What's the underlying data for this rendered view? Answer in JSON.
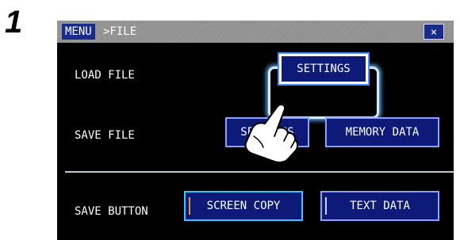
{
  "step": {
    "number": "1"
  },
  "title_bar": {
    "menu_tag": "MENU",
    "breadcrumb": ">FILE",
    "close_label": "×"
  },
  "load_file": {
    "label": "LOAD FILE",
    "settings_button": "SETTINGS"
  },
  "save_file": {
    "label": "SAVE FILE",
    "settings_button": "SETTINGS",
    "memory_data_button": "MEMORY DATA"
  },
  "save_button": {
    "label": "SAVE BUTTON",
    "screen_copy_button": "SCREEN COPY",
    "text_data_button": "TEXT DATA"
  },
  "icons": {
    "pointer": "pointing-hand-icon",
    "close": "close-icon"
  },
  "colors": {
    "screen_bg": "#000000",
    "button_bg": "#0d1a78",
    "button_border": "#8da0ff",
    "active_border": "#34c6ff",
    "highlight": "#6fb6ff"
  }
}
